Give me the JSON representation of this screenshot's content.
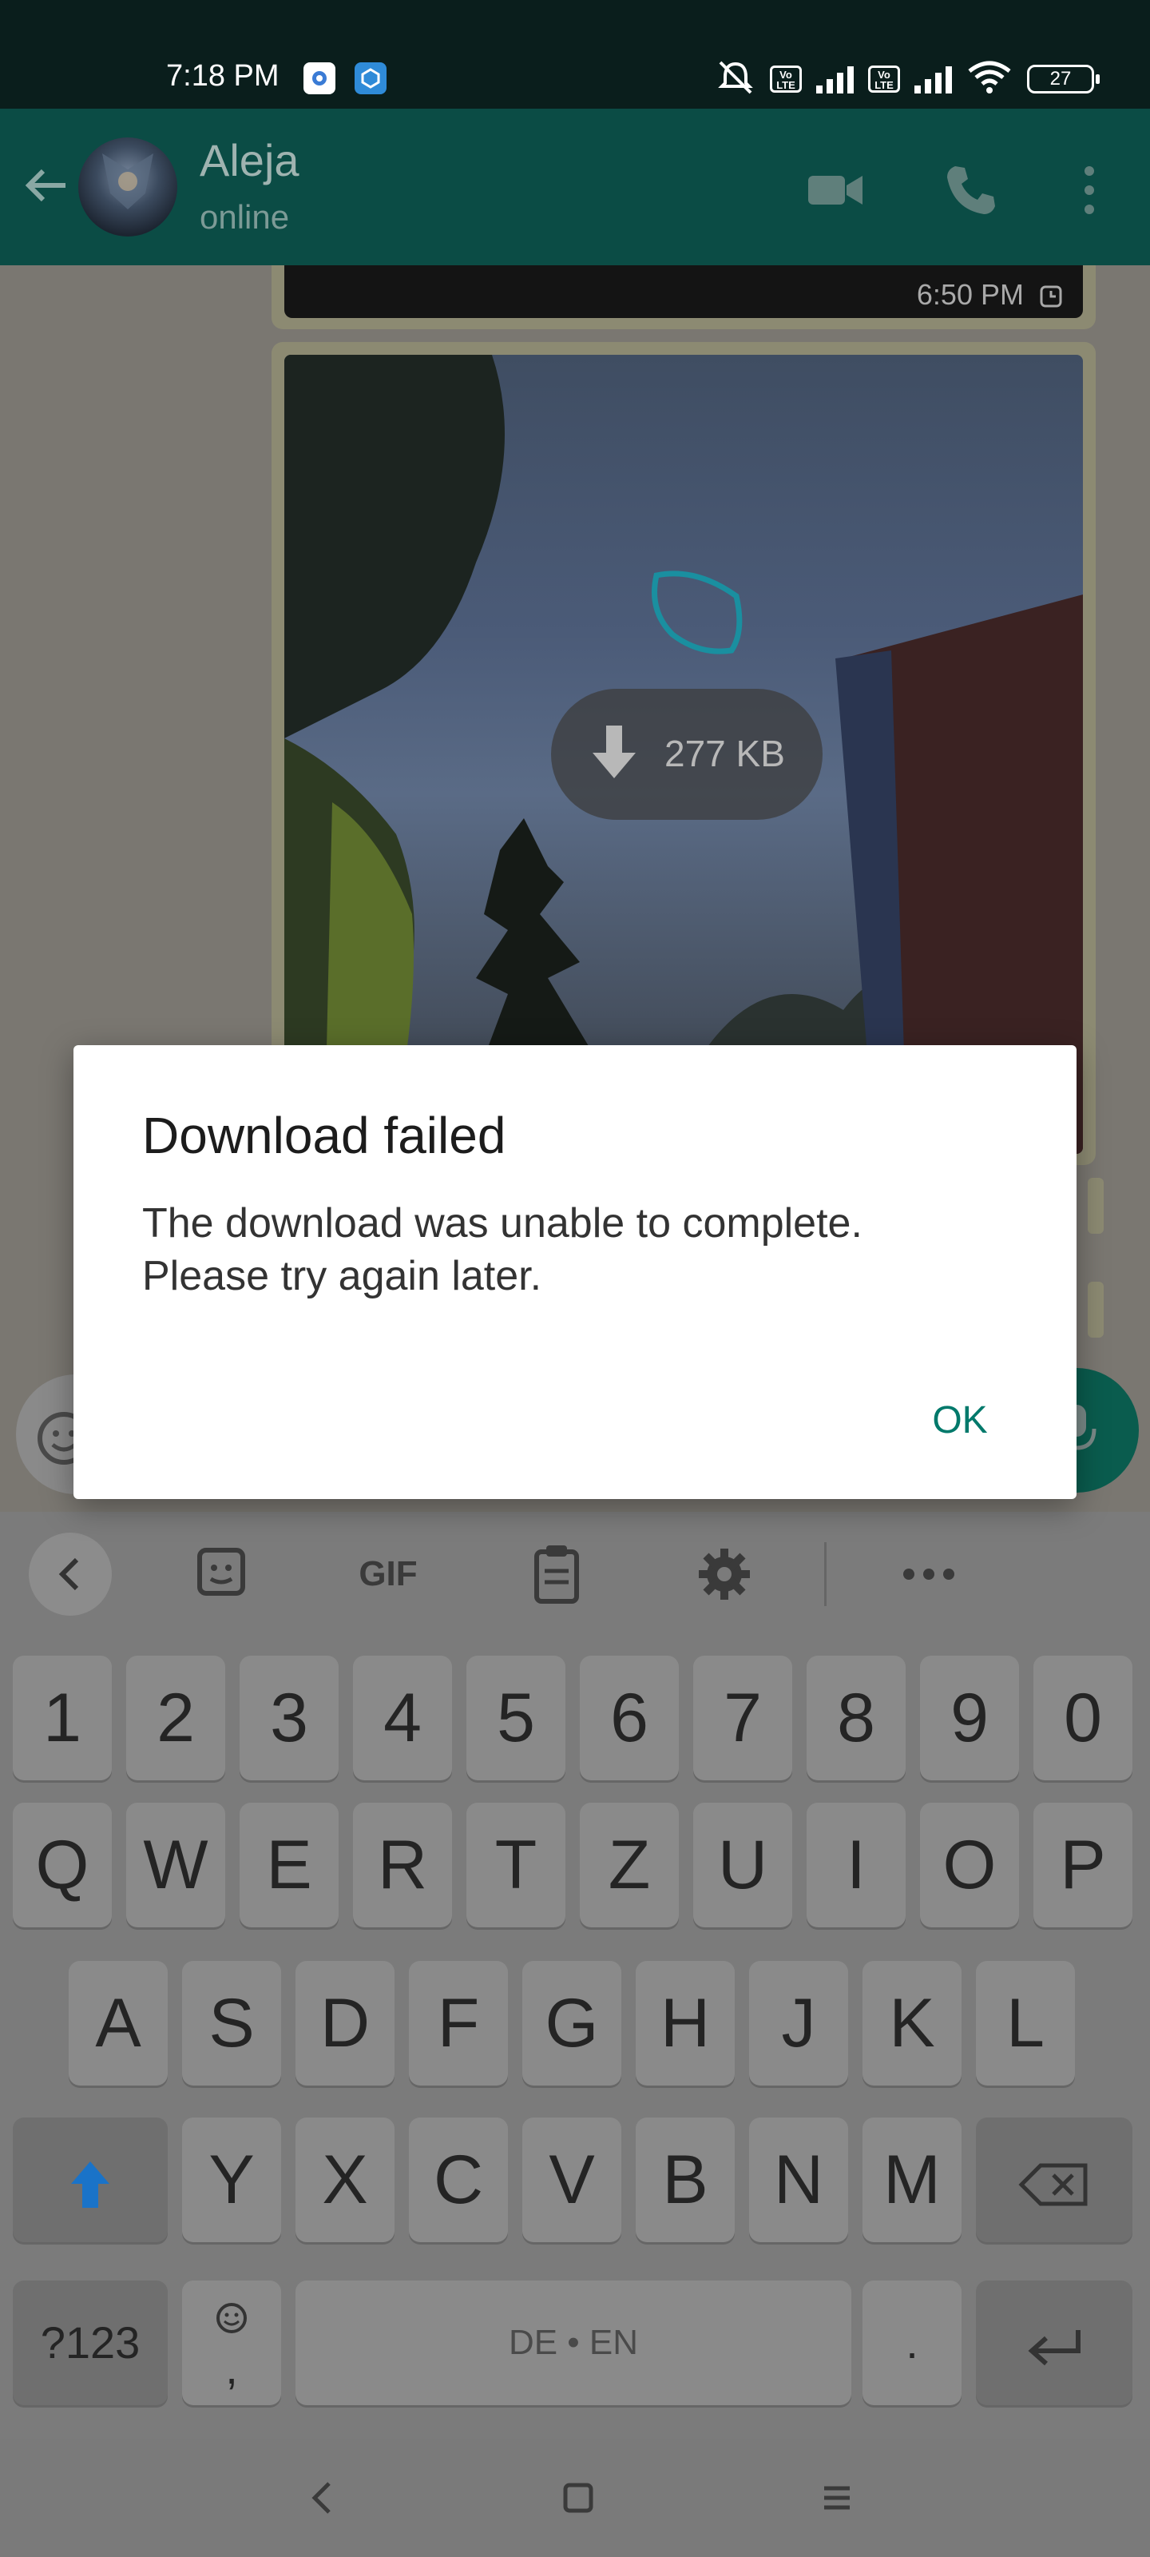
{
  "status_bar": {
    "time": "7:18 PM",
    "volte1": "Vo LTE",
    "volte2": "Vo LTE",
    "battery": "27"
  },
  "header": {
    "contact_name": "Aleja",
    "presence": "online"
  },
  "messages": {
    "prev_time": "6:50 PM",
    "download_size": "277 KB"
  },
  "dialog": {
    "title": "Download failed",
    "body_line1": "The download was unable to complete.",
    "body_line2": "Please try again later.",
    "ok_label": "OK"
  },
  "keyboard": {
    "toolbar": {
      "gif_label": "GIF"
    },
    "row_numbers": [
      "1",
      "2",
      "3",
      "4",
      "5",
      "6",
      "7",
      "8",
      "9",
      "0"
    ],
    "row_1": [
      "Q",
      "W",
      "E",
      "R",
      "T",
      "Z",
      "U",
      "I",
      "O",
      "P"
    ],
    "row_2": [
      "A",
      "S",
      "D",
      "F",
      "G",
      "H",
      "J",
      "K",
      "L"
    ],
    "row_3": [
      "Y",
      "X",
      "C",
      "V",
      "B",
      "N",
      "M"
    ],
    "symbols_label": "?123",
    "comma_label": ",",
    "space_label": "DE • EN",
    "period_label": "."
  },
  "colors": {
    "header_bg": "#0b4c45",
    "accent": "#00796b"
  }
}
